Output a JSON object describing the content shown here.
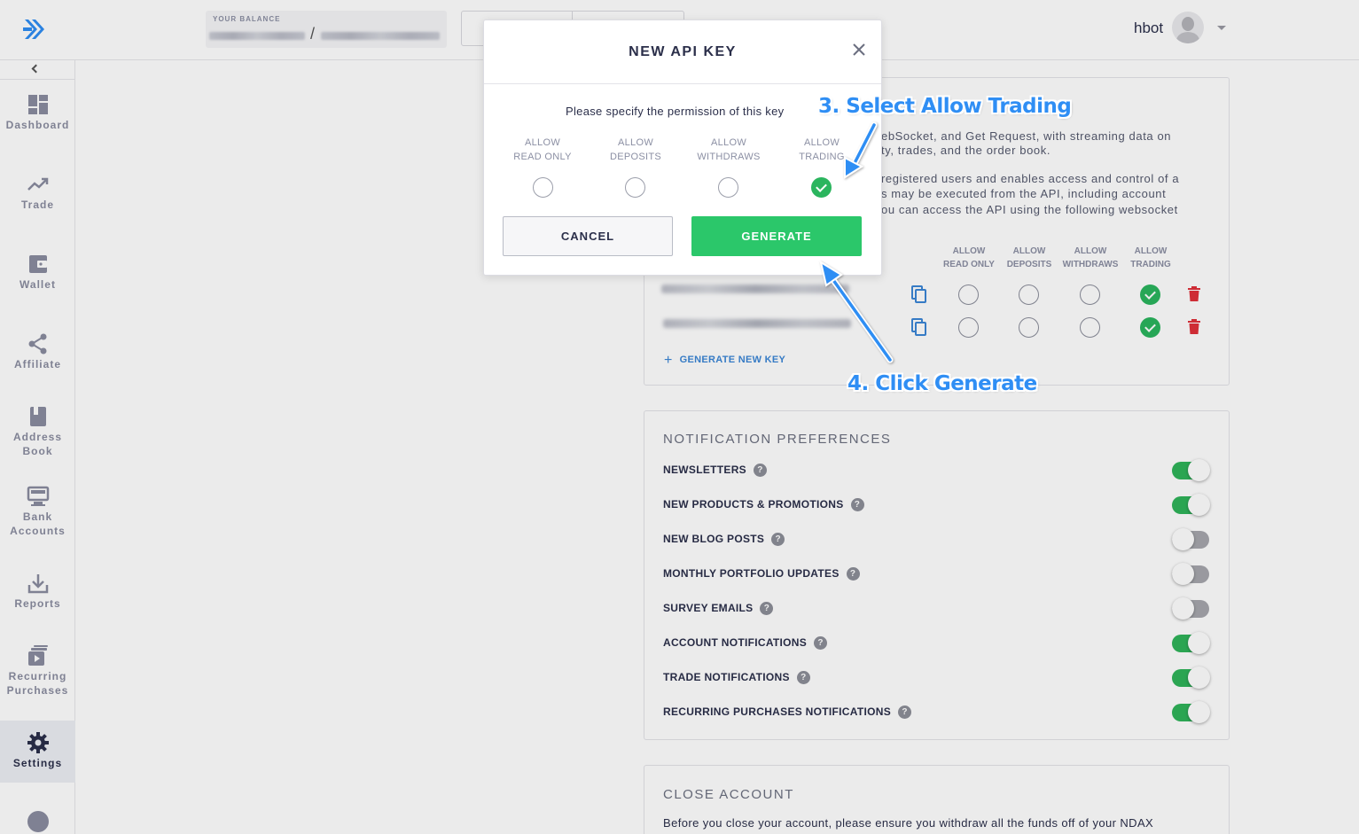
{
  "header": {
    "balance_label": "YOUR BALANCE",
    "balance_separator": "/",
    "username": "hbot"
  },
  "sidebar": {
    "items": [
      {
        "label": "Dashboard",
        "icon": "dashboard-icon"
      },
      {
        "label": "Trade",
        "icon": "trend-icon"
      },
      {
        "label": "Wallet",
        "icon": "wallet-icon"
      },
      {
        "label": "Affiliate",
        "icon": "share-icon"
      },
      {
        "label": "Address Book",
        "icon": "book-icon"
      },
      {
        "label": "Bank Accounts",
        "icon": "bank-icon"
      },
      {
        "label": "Reports",
        "icon": "download-icon"
      },
      {
        "label": "Recurring Purchases",
        "icon": "recurring-icon"
      },
      {
        "label": "Settings",
        "icon": "gear-icon",
        "active": true
      },
      {
        "label": "",
        "icon": "help-icon"
      }
    ]
  },
  "api_section": {
    "desc_lines": [
      "ebSocket, and Get Request, with streaming data on",
      "ty, trades, and the order book.",
      "registered users and enables access and control of a",
      "s may be executed from the API, including account",
      "ou can access the API using the following websocket"
    ],
    "columns": [
      {
        "line1": "ALLOW",
        "line2": "READ ONLY"
      },
      {
        "line1": "ALLOW",
        "line2": "DEPOSITS"
      },
      {
        "line1": "ALLOW",
        "line2": "WITHDRAWS"
      },
      {
        "line1": "ALLOW",
        "line2": "TRADING"
      }
    ],
    "keys": [
      {
        "permissions": [
          false,
          false,
          false,
          true
        ]
      },
      {
        "permissions": [
          false,
          false,
          false,
          true
        ]
      }
    ],
    "generate_new_key_label": "GENERATE NEW KEY",
    "plus": "+"
  },
  "notification_preferences": {
    "title": "NOTIFICATION PREFERENCES",
    "items": [
      {
        "label": "NEWSLETTERS",
        "on": true
      },
      {
        "label": "NEW PRODUCTS & PROMOTIONS",
        "on": true
      },
      {
        "label": "NEW BLOG POSTS",
        "on": false
      },
      {
        "label": "MONTHLY PORTFOLIO UPDATES",
        "on": false
      },
      {
        "label": "SURVEY EMAILS",
        "on": false
      },
      {
        "label": "ACCOUNT NOTIFICATIONS",
        "on": true
      },
      {
        "label": "TRADE NOTIFICATIONS",
        "on": true
      },
      {
        "label": "RECURRING PURCHASES NOTIFICATIONS",
        "on": true
      }
    ],
    "help_glyph": "?"
  },
  "close_account": {
    "title": "CLOSE ACCOUNT",
    "text": "Before you close your account, please ensure you withdraw all the funds off of your NDAX"
  },
  "modal": {
    "title": "NEW API KEY",
    "prompt": "Please specify the permission of this key",
    "permissions": [
      {
        "line1": "ALLOW",
        "line2": "READ ONLY",
        "checked": false
      },
      {
        "line1": "ALLOW",
        "line2": "DEPOSITS",
        "checked": false
      },
      {
        "line1": "ALLOW",
        "line2": "WITHDRAWS",
        "checked": false
      },
      {
        "line1": "ALLOW",
        "line2": "TRADING",
        "checked": true
      }
    ],
    "cancel_label": "CANCEL",
    "generate_label": "GENERATE"
  },
  "annotations": {
    "step3": "3. Select Allow Trading",
    "step4": "4. Click Generate"
  },
  "colors": {
    "accent_green": "#2bc76a",
    "annotation_blue": "#2f8ef4",
    "link_blue": "#3b86d6",
    "trash_red": "#e0303a",
    "text_dark": "#2b2f4a"
  }
}
